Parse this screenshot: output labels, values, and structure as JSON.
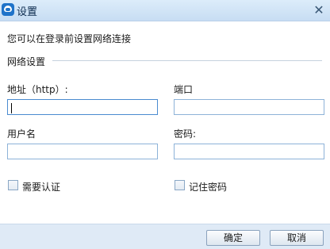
{
  "window": {
    "title": "设置",
    "close_glyph": "✕"
  },
  "intro": "您可以在登录前设置网络连接",
  "network_group": {
    "label": "网络设置"
  },
  "address": {
    "label": "地址（http）:",
    "value": ""
  },
  "port": {
    "label": "端口",
    "value": ""
  },
  "username": {
    "label": "用户名",
    "value": ""
  },
  "password": {
    "label": "密码:",
    "value": ""
  },
  "require_auth": {
    "label": "需要认证",
    "checked": false
  },
  "remember_password": {
    "label": "记住密码",
    "checked": false
  },
  "buttons": {
    "ok": "确定",
    "cancel": "取消"
  }
}
